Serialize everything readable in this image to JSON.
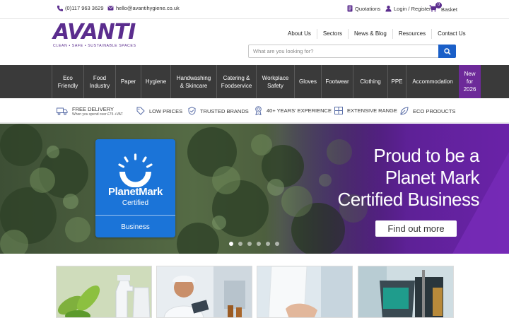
{
  "topbar": {
    "phone": "(0)117 963 3629",
    "email": "hello@avantihygiene.co.uk",
    "quotations": "Quotations",
    "login": "Login / Register",
    "basket": "Basket",
    "basket_count": "0"
  },
  "logo": {
    "text": "AVANTI",
    "tagline": "CLEAN • SAFE • SUSTAINABLE SPACES"
  },
  "nav": [
    "About Us",
    "Sectors",
    "News & Blog",
    "Resources",
    "Contact Us"
  ],
  "search": {
    "placeholder": "What are you looking for?"
  },
  "categories": [
    {
      "label": "Eco\nFriendly"
    },
    {
      "label": "Food\nIndustry"
    },
    {
      "label": "Paper"
    },
    {
      "label": "Hygiene"
    },
    {
      "label": "Handwashing\n& Skincare"
    },
    {
      "label": "Catering &\nFoodservice"
    },
    {
      "label": "Workplace\nSafety"
    },
    {
      "label": "Gloves"
    },
    {
      "label": "Footwear"
    },
    {
      "label": "Clothing"
    },
    {
      "label": "PPE"
    },
    {
      "label": "Accommodation"
    },
    {
      "label": "New\nfor\n2026"
    }
  ],
  "benefits": {
    "delivery": "FREE DELIVERY",
    "delivery_sub": "When you spend over £75 +VAT",
    "low_prices": "LOW PRICES",
    "brands": "TRUSTED BRANDS",
    "experience": "40+ YEARS' EXPERIENCE",
    "range": "EXTENSIVE RANGE",
    "eco": "ECO PRODUCTS"
  },
  "hero": {
    "badge_name": "PlanetMark",
    "badge_certified": "Certified",
    "badge_business": "Business",
    "headline_1": "Proud to be a",
    "headline_2": "Planet Mark",
    "headline_3": "Certified Business",
    "cta": "Find out more",
    "slides_total": 6,
    "active_slide": 1
  },
  "colors": {
    "brand_purple": "#5b2d8e",
    "category_bar": "#3a3a3a",
    "new_highlight": "#6d2a99",
    "search_button": "#1a5fc8",
    "planet_mark_blue": "#1b74d8"
  }
}
